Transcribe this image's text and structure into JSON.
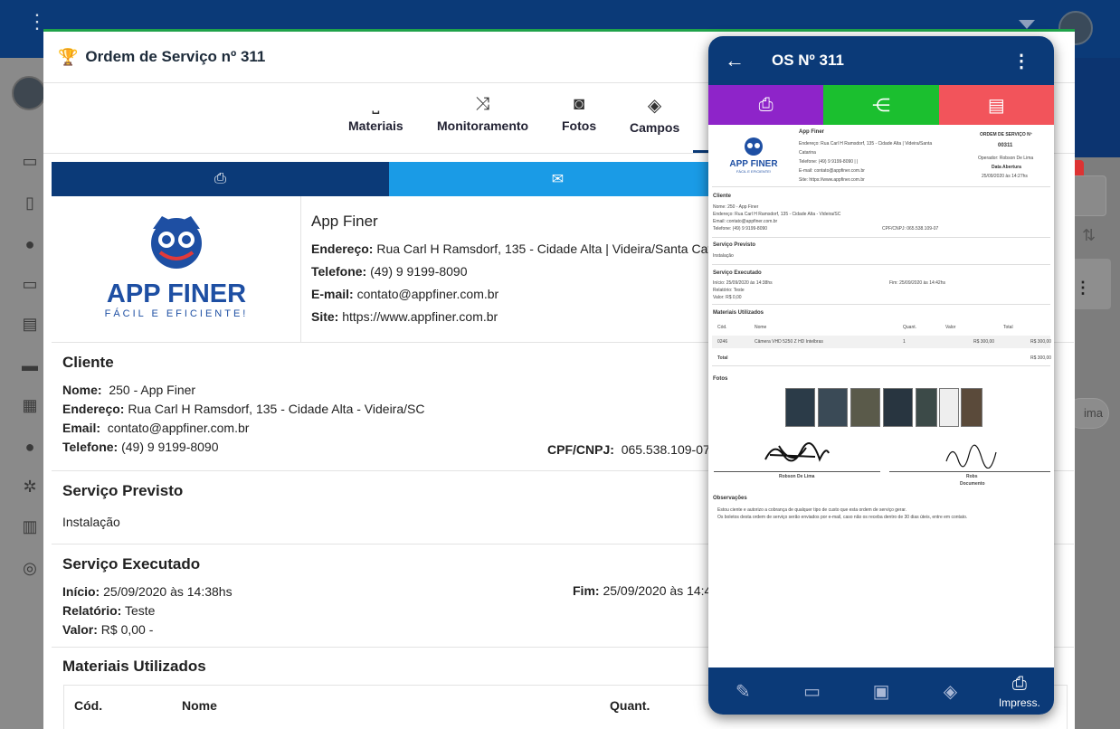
{
  "modal": {
    "title": "Ordem de Serviço nº 311"
  },
  "tabs": [
    {
      "label": "Materiais",
      "icon": "inbox-icon"
    },
    {
      "label": "Monitoramento",
      "icon": "shuffle-icon"
    },
    {
      "label": "Fotos",
      "icon": "camera-icon"
    },
    {
      "label": "Campos",
      "icon": "layers-icon"
    }
  ],
  "company": {
    "name": "App Finer",
    "address_label": "Endereço:",
    "address": "Rua Carl H Ramsdorf, 135 - Cidade Alta | Videira/Santa Catar",
    "phone_label": "Telefone:",
    "phone": "(49) 9 9199-8090",
    "email_label": "E-mail:",
    "email": "contato@appfiner.com.br",
    "site_label": "Site:",
    "site": "https://www.appfiner.com.br",
    "logo_text": "APP FINER",
    "logo_sub": "FÁCIL E EFICIENTE!"
  },
  "cliente": {
    "heading": "Cliente",
    "nome_label": "Nome:",
    "nome": "250 - App Finer",
    "endereco_label": "Endereço:",
    "endereco": "Rua Carl H Ramsdorf, 135 - Cidade Alta - Videira/SC",
    "email_label": "Email:",
    "email": "contato@appfiner.com.br",
    "telefone_label": "Telefone:",
    "telefone": "(49) 9 9199-8090",
    "cpf_label": "CPF/CNPJ:",
    "cpf": "065.538.109-07"
  },
  "servico_previsto": {
    "heading": "Serviço Previsto",
    "value": "Instalação"
  },
  "servico_executado": {
    "heading": "Serviço Executado",
    "inicio_label": "Início:",
    "inicio": "25/09/2020 às 14:38hs",
    "fim_label": "Fim:",
    "fim": "25/09/2020 às 14:42",
    "relatorio_label": "Relatório:",
    "relatorio": "Teste",
    "valor_label": "Valor:",
    "valor": "R$ 0,00 -"
  },
  "materiais": {
    "heading": "Materiais Utilizados",
    "columns": [
      "Cód.",
      "Nome",
      "Quant."
    ]
  },
  "phone": {
    "title": "OS Nº 311",
    "buttons": [
      "print-icon",
      "share-icon",
      "pdf-icon"
    ],
    "colors": {
      "print": "#8e24c9",
      "share": "#1bbf2f",
      "pdf": "#f2545b",
      "header": "#0b3a78"
    },
    "doc": {
      "company": "App Finer",
      "endereco": "Endereço: Rua Carl H Ramsdorf, 135 - Cidade Alta | Videira/Santa",
      "endereco2": "Catarina",
      "telefone": "Telefone: (49) 9 9199-8090 | |",
      "email": "E-mail: contato@appfiner.com.br",
      "site": "Site: https://www.appfiner.com.br",
      "os_title": "ORDEM DE SERVIÇO Nº",
      "os_num": "00311",
      "operador": "Operador: Robson De Lima",
      "data_label": "Data Abertura",
      "data": "25/09/2020 às 14:27hs",
      "cliente": "Cliente",
      "c_nome": "Nome: 250 - App Finer",
      "c_end": "Endereço: Rua Carl H Ramsdorf, 135 - Cidade Alta - Videira/SC",
      "c_email": "Email: contato@appfiner.com.br",
      "c_tel": "Telefone: (49) 9 9199-8090",
      "c_cpf": "CPF/CNPJ: 065.538.109-07",
      "sp": "Serviço Previsto",
      "sp_v": "Instalação",
      "se": "Serviço Executado",
      "se_ini": "Início: 25/09/2020 às 14:38hs",
      "se_fim": "Fim: 25/09/2020 às 14:42hs",
      "se_rel": "Relatório: Teste",
      "se_val": "Valor: R$ 0,00",
      "mu": "Materiais Utilizados",
      "mu_cols": [
        "Cód.",
        "Nome",
        "Quant.",
        "Valor",
        "Total"
      ],
      "mu_row": [
        "0246",
        "Câmera VHD 5250 Z HD Intelbras",
        "1",
        "R$ 300,00",
        "R$ 300,00"
      ],
      "mu_total_label": "Total",
      "mu_total": "R$ 300,00",
      "fotos": "Fotos",
      "sig1": "Robson De Lima",
      "sig2a": "Robs",
      "sig2b": "Documento",
      "obs": "Observações",
      "obs1": "Estou ciente e autorizo a cobrança de qualquer tipo de custo que esta ordem de serviço gerar.",
      "obs2": "Os boletos desta ordem de serviço serão enviados por e-mail, caso não os receba dentro de 30 dias úteis, entre em contato."
    },
    "bottom": {
      "active_label": "Impress."
    }
  }
}
